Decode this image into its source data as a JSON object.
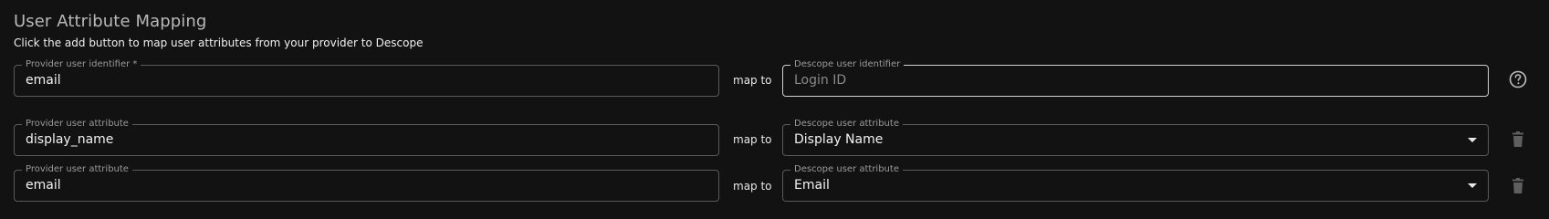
{
  "section": {
    "title": "User Attribute Mapping",
    "subtitle": "Click the add button to map user attributes from your provider to Descope"
  },
  "rows": [
    {
      "provider_label": "Provider user identifier *",
      "provider_value": "email",
      "map_to": "map to",
      "descope_label": "Descope user identifier",
      "descope_placeholder": "Login ID",
      "action_icon": "help-circle-icon"
    },
    {
      "provider_label": "Provider user attribute",
      "provider_value": "display_name",
      "map_to": "map to",
      "descope_label": "Descope user attribute",
      "descope_value": "Display Name",
      "action_icon": "trash-icon"
    },
    {
      "provider_label": "Provider user attribute",
      "provider_value": "email",
      "map_to": "map to",
      "descope_label": "Descope user attribute",
      "descope_value": "Email",
      "action_icon": "trash-icon"
    }
  ],
  "colors": {
    "background": "#121212",
    "border": "#5a5a5a",
    "text": "#f2f2f2",
    "muted": "#9a9a9a"
  }
}
